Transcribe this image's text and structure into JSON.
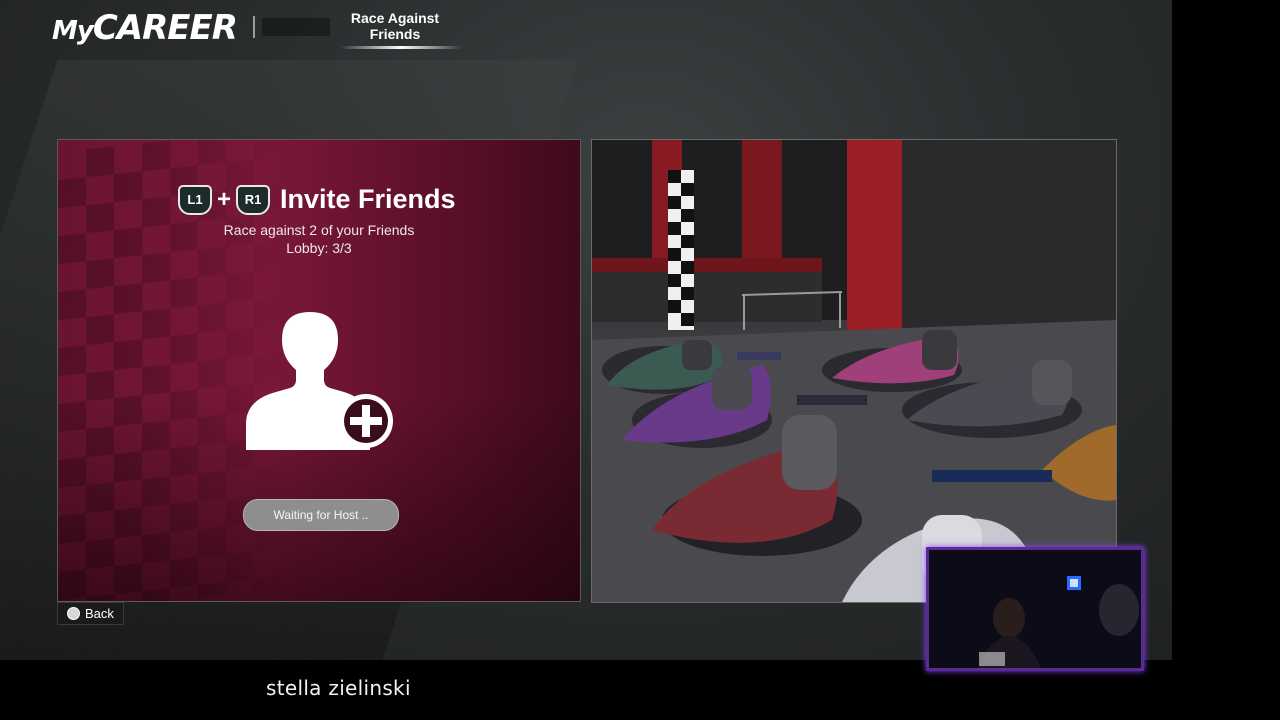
{
  "header": {
    "logo_prefix": "My",
    "logo_main": "CAREER",
    "active_tab_line1": "Race Against",
    "active_tab_line2": "Friends"
  },
  "invite": {
    "left_button": "L1",
    "plus": "+",
    "right_button": "R1",
    "title": "Invite Friends",
    "subtitle": "Race against 2 of your Friends",
    "lobby": "Lobby: 3/3",
    "waiting_label": "Waiting for Host ..",
    "avatar_icon": "add-user-icon"
  },
  "footer": {
    "back_label": "Back",
    "back_icon": "circle-button-icon"
  },
  "stream": {
    "streamer_name": "stella zielinski"
  },
  "colors": {
    "panel_maroon": "#6a1430",
    "webcam_border": "#5b2a94"
  }
}
